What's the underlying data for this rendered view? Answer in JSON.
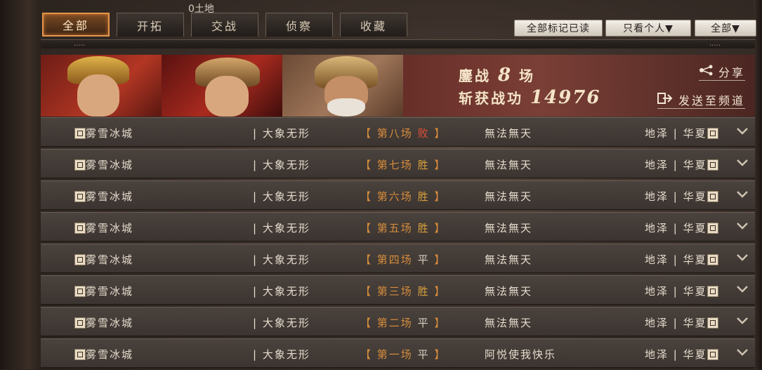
{
  "top_hint": "0土地",
  "tabs": [
    {
      "label": "全部",
      "active": true
    },
    {
      "label": "开拓",
      "active": false
    },
    {
      "label": "交战",
      "active": false
    },
    {
      "label": "侦察",
      "active": false
    },
    {
      "label": "收藏",
      "active": false
    }
  ],
  "toolbar": {
    "mark_read": "全部标记已读",
    "filter_personal": "只看个人▼",
    "filter_all": "全部▼"
  },
  "banner": {
    "battles_label": "鏖战",
    "battles_count": "8",
    "battles_unit": "场",
    "merit_label": "斩获战功",
    "merit_value": "14976",
    "share_label": "分享",
    "send_label": "发送至频道"
  },
  "colors": {
    "accent": "#e3964a",
    "lose": "#e0503a",
    "win": "#d9a03c"
  },
  "rows": [
    {
      "left": "雾雪冰城",
      "mid": "| 大象无形",
      "round": "第八场",
      "result": "败",
      "result_type": "lose",
      "opponent": "無法無天",
      "right": "地泽 | 华夏"
    },
    {
      "left": "雾雪冰城",
      "mid": "| 大象无形",
      "round": "第七场",
      "result": "胜",
      "result_type": "win",
      "opponent": "無法無天",
      "right": "地泽 | 华夏"
    },
    {
      "left": "雾雪冰城",
      "mid": "| 大象无形",
      "round": "第六场",
      "result": "胜",
      "result_type": "win",
      "opponent": "無法無天",
      "right": "地泽 | 华夏"
    },
    {
      "left": "雾雪冰城",
      "mid": "| 大象无形",
      "round": "第五场",
      "result": "胜",
      "result_type": "win",
      "opponent": "無法無天",
      "right": "地泽 | 华夏"
    },
    {
      "left": "雾雪冰城",
      "mid": "| 大象无形",
      "round": "第四场",
      "result": "平",
      "result_type": "draw",
      "opponent": "無法無天",
      "right": "地泽 | 华夏"
    },
    {
      "left": "雾雪冰城",
      "mid": "| 大象无形",
      "round": "第三场",
      "result": "胜",
      "result_type": "win",
      "opponent": "無法無天",
      "right": "地泽 | 华夏"
    },
    {
      "left": "雾雪冰城",
      "mid": "| 大象无形",
      "round": "第二场",
      "result": "平",
      "result_type": "draw",
      "opponent": "無法無天",
      "right": "地泽 | 华夏"
    },
    {
      "left": "雾雪冰城",
      "mid": "| 大象无形",
      "round": "第一场",
      "result": "平",
      "result_type": "draw",
      "opponent": "阿悦使我快乐",
      "right": "地泽 | 华夏"
    }
  ]
}
